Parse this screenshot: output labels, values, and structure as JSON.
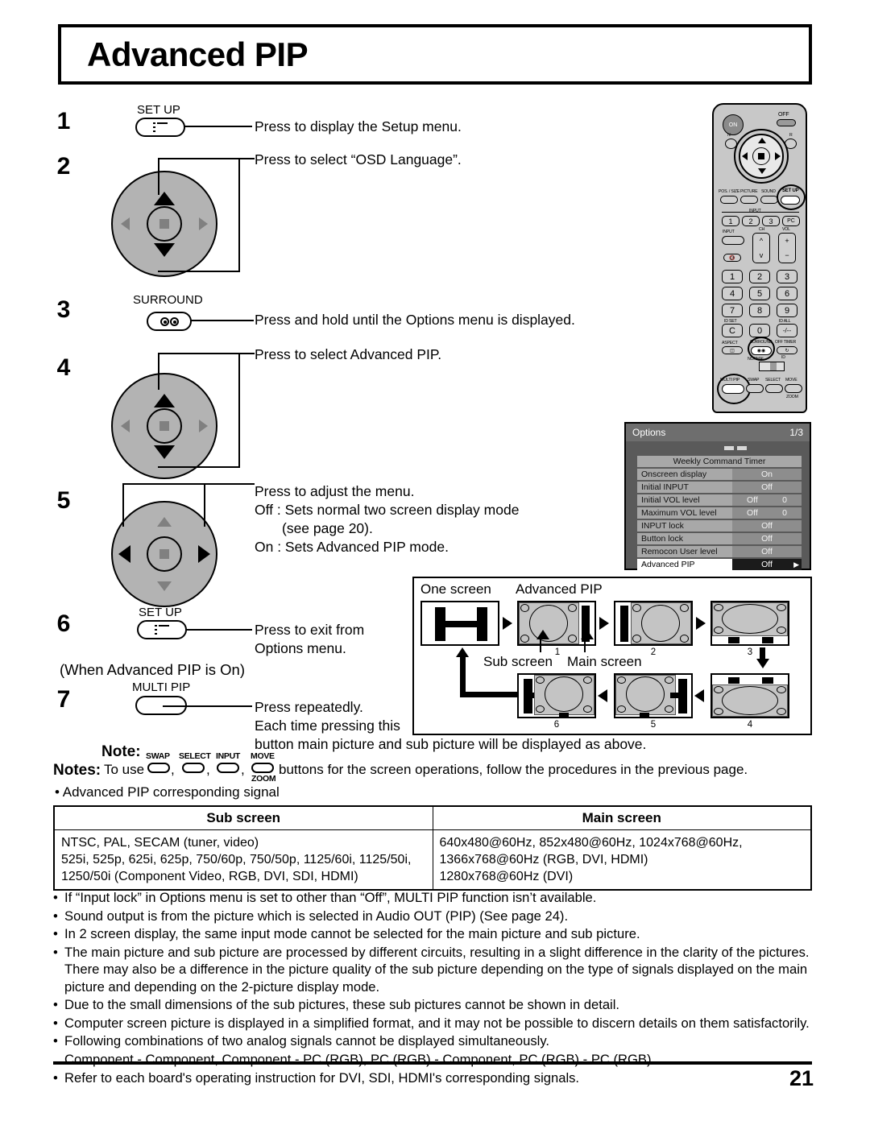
{
  "document": {
    "title": "Advanced PIP",
    "page_number": "21"
  },
  "steps": [
    {
      "num": "1",
      "button_caption": "SET UP",
      "icon": "setup-icon",
      "text": [
        "Press to display the Setup menu."
      ]
    },
    {
      "num": "2",
      "button_caption": "",
      "icon": "joystick-up-down-icon",
      "text": [
        "Press to select “OSD Language”."
      ]
    },
    {
      "num": "3",
      "button_caption": "SURROUND",
      "icon": "surround-icon",
      "text": [
        "Press and hold until the Options menu is displayed."
      ]
    },
    {
      "num": "4",
      "button_caption": "",
      "icon": "joystick-up-down-icon",
      "text": [
        "Press to select Advanced PIP."
      ]
    },
    {
      "num": "5",
      "button_caption": "",
      "icon": "joystick-left-right-icon",
      "text": [
        "Press to adjust the menu.",
        "Off : Sets  normal  two  screen  display  mode",
        "(see page 20).",
        "On : Sets Advanced PIP mode."
      ]
    },
    {
      "num": "6",
      "button_caption": "SET UP",
      "icon": "setup-icon",
      "text": [
        "Press to exit from",
        "Options menu."
      ]
    },
    {
      "num": "7",
      "button_caption": "MULTI PIP",
      "icon": "multi-pip-icon",
      "text": [
        "Press repeatedly.",
        "Each time pressing this",
        "button main picture and sub picture will be displayed as above."
      ]
    }
  ],
  "condition_label": "(When Advanced PIP is On)",
  "remote": {
    "power_on": "ON",
    "power_off": "OFF",
    "n_label": "N",
    "r_label": "R",
    "row_labels": [
      "POS. / SIZE",
      "PICTURE",
      "SOUND",
      "SET UP"
    ],
    "input_group_label": "INPUT",
    "input_buttons": [
      "1",
      "2",
      "3",
      "PC"
    ],
    "input_label": "INPUT",
    "ch_label": "CH",
    "vol_label": "VOL",
    "vol_plus": "+",
    "vol_minus": "−",
    "numbers": [
      "1",
      "2",
      "3",
      "4",
      "5",
      "6",
      "7",
      "8",
      "9",
      "C",
      "0",
      "-/--"
    ],
    "id_set": "ID SET",
    "id_all": "ID ALL",
    "aspect": "ASPECT",
    "surround": "SURROUND",
    "off_timer": "OFF TIMER",
    "normal": "NORMAL",
    "id": "ID",
    "bottom_buttons": [
      "MULTI PIP",
      "SWAP",
      "SELECT",
      "MOVE"
    ],
    "zoom_label": "ZOOM"
  },
  "osd": {
    "title": "Options",
    "page_indicator": "1/3",
    "rows": [
      {
        "label": "Weekly Command Timer",
        "value": "",
        "wide": true,
        "selected": false
      },
      {
        "label": "Onscreen display",
        "value": "On",
        "value2": "",
        "selected": false
      },
      {
        "label": "Initial INPUT",
        "value": "Off",
        "value2": "",
        "selected": false
      },
      {
        "label": "Initial VOL level",
        "value": "Off",
        "value2": "0",
        "selected": false
      },
      {
        "label": "Maximum VOL level",
        "value": "Off",
        "value2": "0",
        "selected": false
      },
      {
        "label": "INPUT lock",
        "value": "Off",
        "value2": "",
        "selected": false
      },
      {
        "label": "Button lock",
        "value": "Off",
        "value2": "",
        "selected": false
      },
      {
        "label": "Remocon User level",
        "value": "Off",
        "value2": "",
        "selected": false
      },
      {
        "label": "Advanced PIP",
        "value": "Off",
        "value2": "",
        "selected": true
      }
    ]
  },
  "flow": {
    "label_one_screen": "One screen",
    "label_advanced_pip": "Advanced PIP",
    "label_sub_screen": "Sub screen",
    "label_main_screen": "Main screen",
    "screen_numbers": [
      "1",
      "2",
      "3",
      "4",
      "5",
      "6"
    ]
  },
  "notes": {
    "note_heading": "Note:",
    "notes_heading": "Notes:",
    "to_use_prefix": "To use",
    "mini_buttons": [
      "SWAP",
      "SELECT",
      "INPUT",
      "MOVE"
    ],
    "zoom_caption": "ZOOM",
    "to_use_suffix": "buttons for the screen operations, follow the procedures in the previous page.",
    "first_bullet": "Advanced PIP corresponding signal"
  },
  "table": {
    "headers": [
      "Sub screen",
      "Main screen"
    ],
    "rows": [
      {
        "sub": "NTSC, PAL, SECAM (tuner, video)\n525i, 525p, 625i, 625p, 750/60p, 750/50p, 1125/60i, 1125/50i,\n1250/50i (Component Video, RGB, DVI, SDI, HDMI)",
        "main": "640x480@60Hz,  852x480@60Hz,  1024x768@60Hz,\n1366x768@60Hz (RGB, DVI, HDMI)\n1280x768@60Hz (DVI)"
      }
    ]
  },
  "bullets": [
    "If “Input lock” in Options menu is set to other than “Off”, MULTI PIP function isn’t available.",
    "Sound output is from the picture which is selected in Audio OUT (PIP) (See page 24).",
    "In 2 screen display, the same input mode cannot be selected for the main picture and sub picture.",
    "The main picture and sub picture are processed by different circuits, resulting in a slight difference in the clarity of the pictures. There may also be a difference in the picture quality of the sub picture depending on the type of signals displayed on the main picture and depending on the 2-picture display mode.",
    "Due to the small dimensions of the sub pictures, these sub pictures cannot be shown in detail.",
    "Computer screen picture is displayed in a simplified format, and it may not be possible to discern details on them satisfactorily.",
    "Following combinations of two analog signals cannot be displayed simultaneously.",
    "Refer to each board's operating instruction for DVI, SDI, HDMI's corresponding signals."
  ],
  "bullet_subline": "Component - Component, Component - PC (RGB), PC (RGB) - Component, PC (RGB) - PC (RGB)"
}
